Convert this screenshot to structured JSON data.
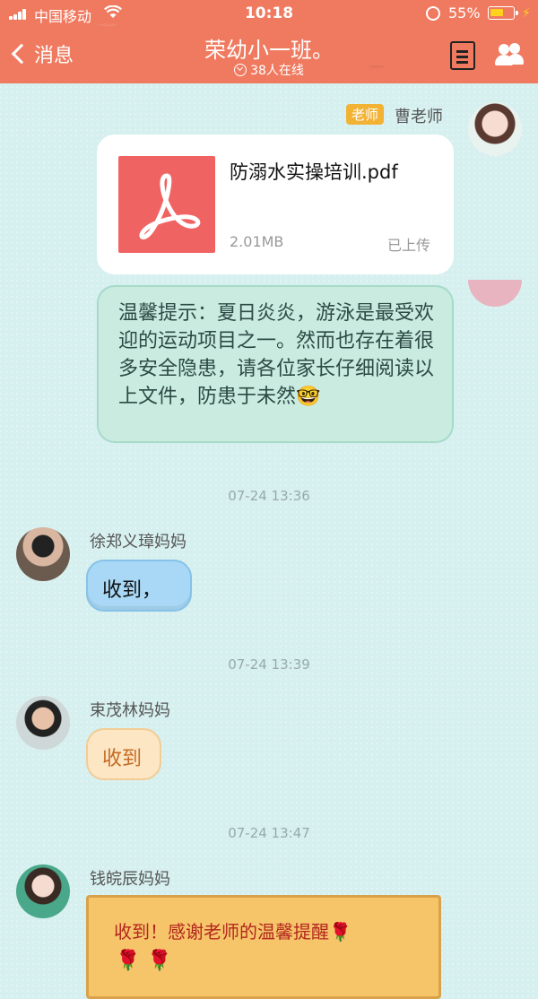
{
  "status_bar": {
    "carrier": "中国移动",
    "time": "10:18",
    "battery": "55%",
    "battery_level": 0.55
  },
  "header": {
    "back_label": "消息",
    "title": "荣幼小一班。",
    "subtitle": "38人在线"
  },
  "messages": [
    {
      "sender": "曹老师",
      "role": "老师",
      "file_name": "防溺水实操培训.pdf",
      "file_size": "2.01MB",
      "file_status": "已上传"
    },
    {
      "text": "温馨提示：夏日炎炎，游泳是最受欢迎的运动项目之一。然而也存在着很多安全隐患，请各位家长仔细阅读以上文件，防患于未然🤓"
    },
    {
      "timestamp": "07-24 13:36"
    },
    {
      "sender": "徐郑义璋妈妈",
      "text": "收到，"
    },
    {
      "timestamp": "07-24 13:39"
    },
    {
      "sender": "束茂林妈妈",
      "text": "收到"
    },
    {
      "timestamp": "07-24 13:47"
    },
    {
      "sender": "钱皖辰妈妈",
      "text": "收到！感谢老师的温馨提醒🌹",
      "decor": "🌹🌹"
    }
  ],
  "icons": [
    "signal-icon",
    "wifi-icon",
    "lock-icon",
    "battery-icon",
    "bolt-icon",
    "back-chevron-icon",
    "doc-icon",
    "group-icon",
    "pdf-icon"
  ]
}
